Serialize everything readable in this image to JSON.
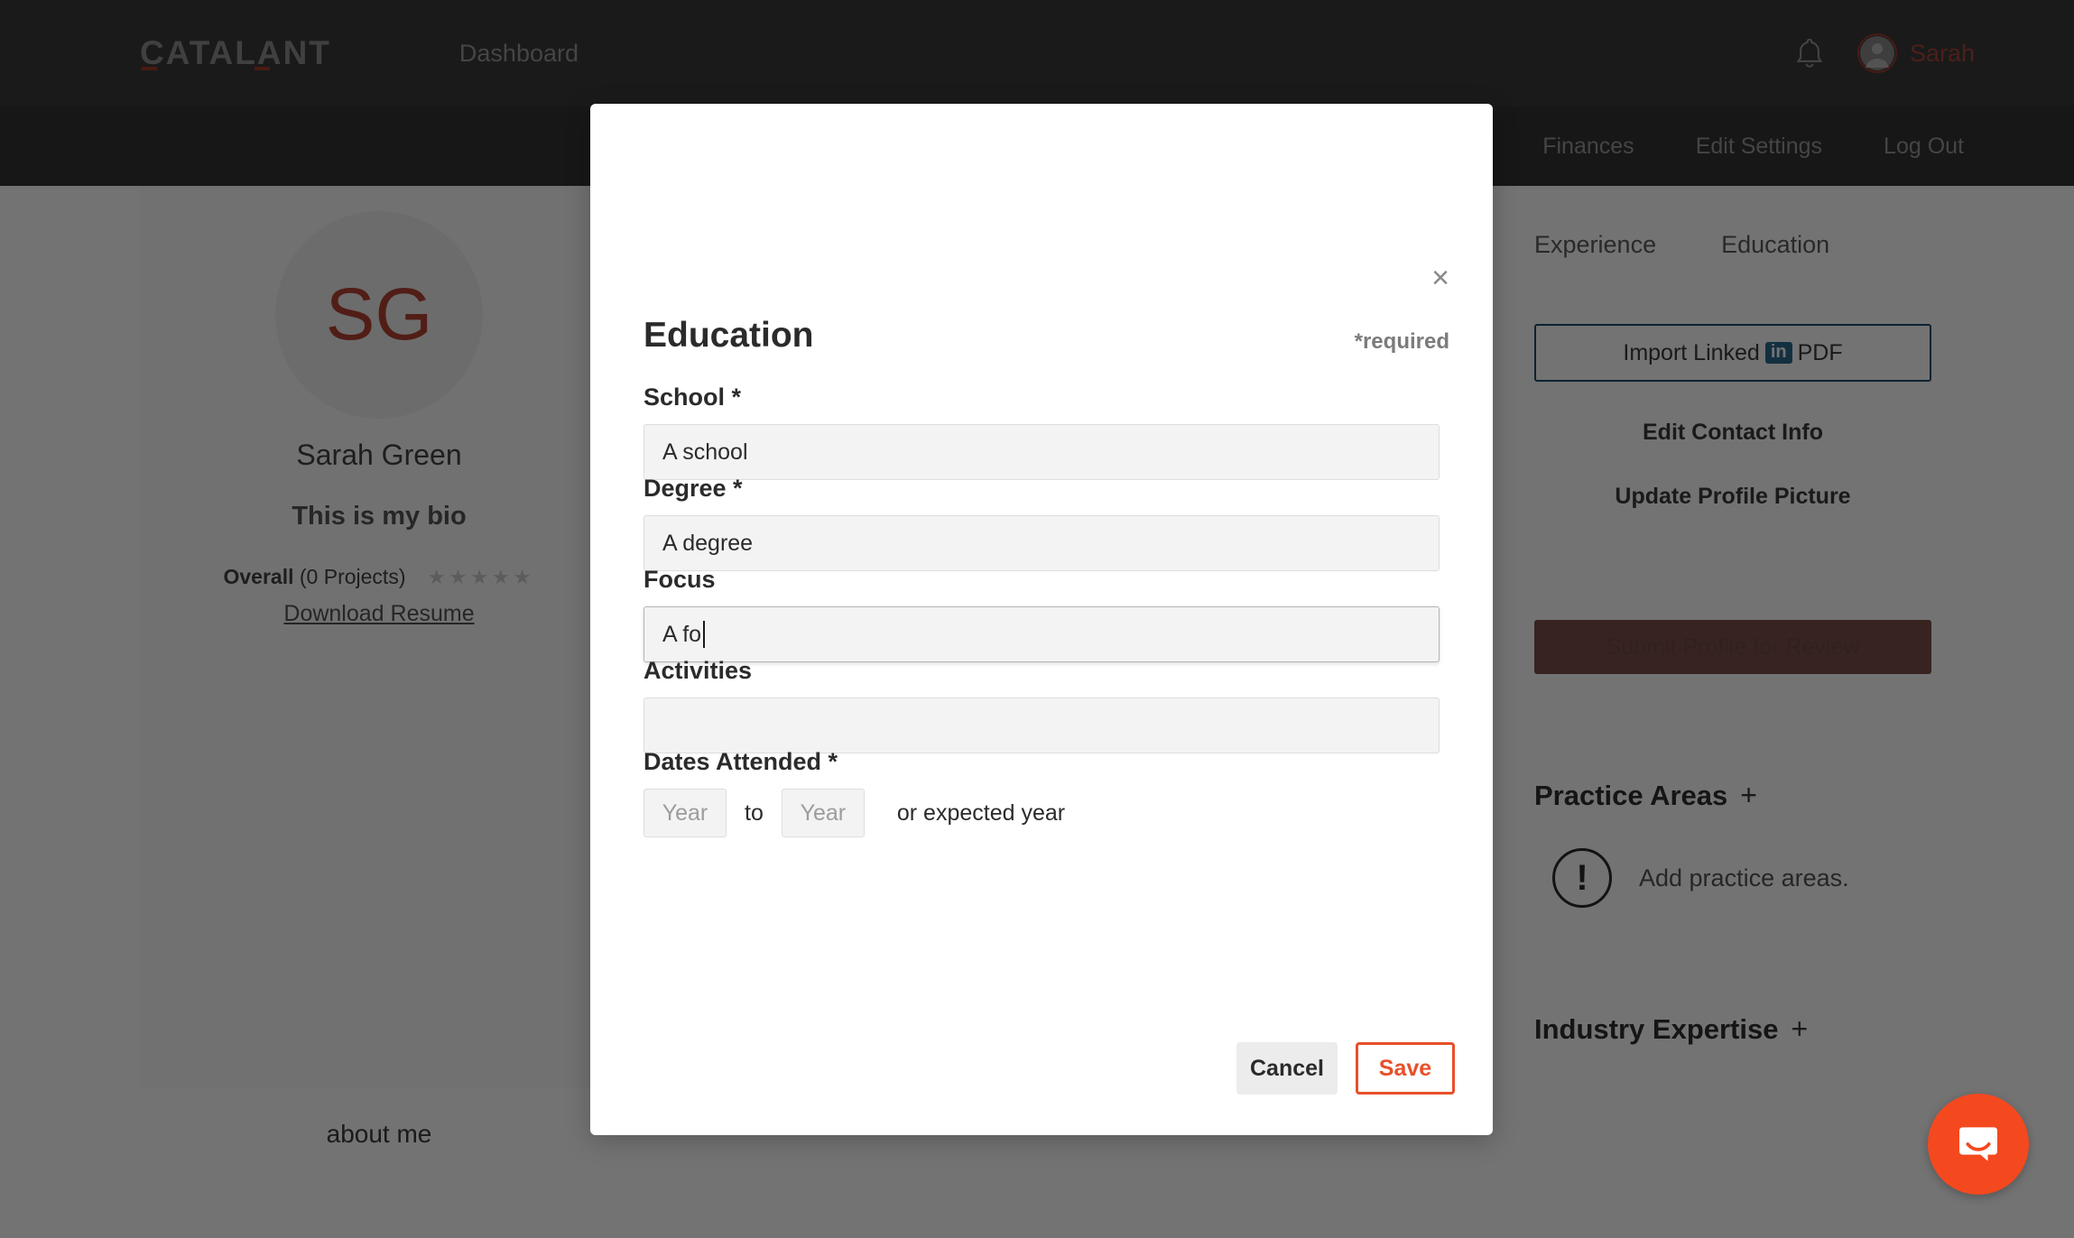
{
  "topbar": {
    "logo": "CATALANT",
    "dashboard_label": "Dashboard",
    "bell_icon": "bell-icon",
    "user_name": "Sarah",
    "avatar_icon": "user-avatar-icon"
  },
  "subnav": {
    "items": [
      "Finances",
      "Edit Settings",
      "Log Out"
    ]
  },
  "profile": {
    "initials": "SG",
    "name": "Sarah Green",
    "bio": "This is my bio",
    "overall_label": "Overall",
    "overall_projects": "(0 Projects)",
    "stars": "★★★★★",
    "download_resume": "Download Resume",
    "about_me": "about me"
  },
  "sidebar": {
    "tabs": [
      "Experience",
      "Education"
    ],
    "import_prefix": "Import Linked",
    "import_badge": "in",
    "import_suffix": "PDF",
    "edit_contact": "Edit Contact Info",
    "update_picture": "Update Profile Picture",
    "submit_profile": "Submit Profile for Review",
    "practice_areas_heading": "Practice Areas",
    "practice_areas_empty": "Add practice areas.",
    "industry_expertise_heading": "Industry Expertise",
    "plus": "+",
    "warn_glyph": "!"
  },
  "modal": {
    "title": "Education",
    "required_note": "*required",
    "close_glyph": "×",
    "fields": [
      {
        "label": "School *",
        "value": "A school",
        "placeholder": ""
      },
      {
        "label": "Degree *",
        "value": "A degree",
        "placeholder": ""
      },
      {
        "label": "Focus",
        "value": "A fo",
        "placeholder": ""
      },
      {
        "label": "Activities",
        "value": "",
        "placeholder": ""
      }
    ],
    "dates": {
      "label": "Dates Attended *",
      "year_from_placeholder": "Year",
      "year_from_value": "",
      "to_label": "to",
      "year_to_placeholder": "Year",
      "year_to_value": "",
      "note": "or expected year"
    },
    "cancel_label": "Cancel",
    "save_label": "Save"
  },
  "intercom": {
    "icon": "chat-bubble-icon"
  },
  "colors": {
    "brand_red": "#a33c2d",
    "accent_orange": "#e8502a",
    "intercom_orange": "#f4491f",
    "linkedin_blue": "#2a6c8f",
    "topbar_dark": "#3b3b3b"
  }
}
